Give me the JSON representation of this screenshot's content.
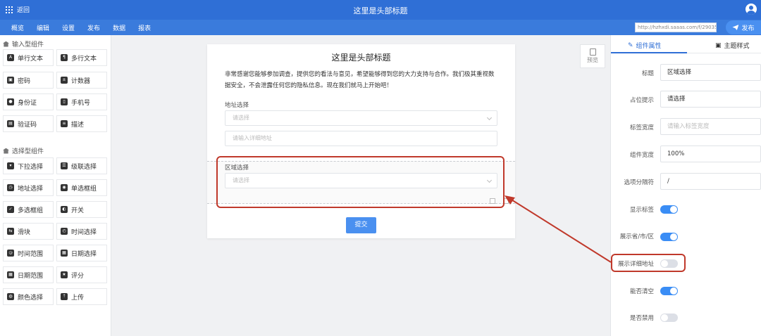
{
  "header": {
    "back_label": "返回",
    "title": "这里是头部标题",
    "nav": [
      "概览",
      "编辑",
      "设置",
      "发布",
      "数据",
      "报表"
    ],
    "url": "http://hzhxdi.saaas.com/f/290353",
    "publish_label": "发布"
  },
  "sidebar": {
    "input_group_title": "输入型组件",
    "input_items": [
      {
        "label": "单行文本",
        "icon": "text-icon"
      },
      {
        "label": "多行文本",
        "icon": "paragraph-icon"
      },
      {
        "label": "密码",
        "icon": "lock-icon"
      },
      {
        "label": "计数器",
        "icon": "counter-icon"
      },
      {
        "label": "身份证",
        "icon": "id-card-icon"
      },
      {
        "label": "手机号",
        "icon": "phone-icon"
      },
      {
        "label": "验证码",
        "icon": "captcha-icon"
      },
      {
        "label": "描述",
        "icon": "description-icon"
      }
    ],
    "select_group_title": "选择型组件",
    "select_items": [
      {
        "label": "下拉选择",
        "icon": "dropdown-icon"
      },
      {
        "label": "级联选择",
        "icon": "cascader-icon"
      },
      {
        "label": "地址选择",
        "icon": "map-icon"
      },
      {
        "label": "单选框组",
        "icon": "radio-icon"
      },
      {
        "label": "多选框组",
        "icon": "checkbox-icon"
      },
      {
        "label": "开关",
        "icon": "switch-icon"
      },
      {
        "label": "滑块",
        "icon": "slider-icon"
      },
      {
        "label": "时间选择",
        "icon": "clock-icon"
      },
      {
        "label": "时间范围",
        "icon": "time-range-icon"
      },
      {
        "label": "日期选择",
        "icon": "calendar-icon"
      },
      {
        "label": "日期范围",
        "icon": "date-range-icon"
      },
      {
        "label": "评分",
        "icon": "star-icon"
      },
      {
        "label": "颜色选择",
        "icon": "palette-icon"
      },
      {
        "label": "上传",
        "icon": "upload-icon"
      }
    ]
  },
  "form": {
    "title": "这里是头部标题",
    "description": "非常感谢您能够参加调查，提供您的看法与意见，希望能够得到您的大力支持与合作。我们极其重视数据安全，不会泄露任何您的隐私信息。现在我们就马上开始吧！",
    "address_label": "地址选择",
    "address_placeholder": "请选择",
    "detail_placeholder": "请输入详细地址",
    "region_label": "区域选择",
    "region_placeholder": "请选择",
    "submit_label": "提交"
  },
  "preview_label": "预览",
  "panel": {
    "tab_props": "组件属性",
    "tab_theme": "主题样式",
    "fields": [
      {
        "label": "标题",
        "value": "区域选择",
        "placeholder": false
      },
      {
        "label": "占位提示",
        "value": "请选择",
        "placeholder": false
      },
      {
        "label": "标签宽度",
        "value": "请输入标签宽度",
        "placeholder": true
      },
      {
        "label": "组件宽度",
        "value": "100%",
        "placeholder": false
      },
      {
        "label": "选项分隔符",
        "value": "/",
        "placeholder": false
      }
    ],
    "toggles": [
      {
        "label": "显示标签",
        "on": true
      },
      {
        "label": "展示省/市/区",
        "on": true
      },
      {
        "label": "展示详细地址",
        "on": false
      },
      {
        "label": "能否清空",
        "on": true
      },
      {
        "label": "是否禁用",
        "on": false
      }
    ]
  },
  "colors": {
    "header": "#2f6fd6",
    "accent": "#3a8df5",
    "annotation": "#c0392b"
  }
}
